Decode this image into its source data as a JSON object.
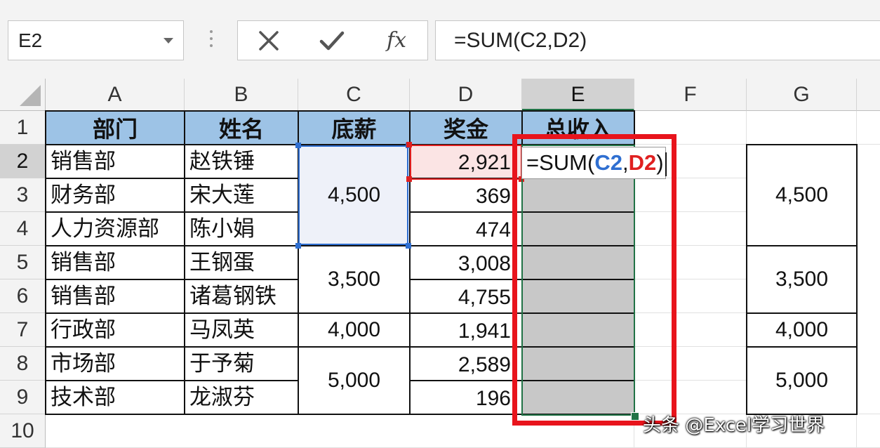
{
  "formula_bar": {
    "name_box": "E2",
    "cancel_icon": "close-icon",
    "enter_icon": "checkmark-icon",
    "fx_label": "fx",
    "formula": "=SUM(C2,D2)"
  },
  "columns": [
    "A",
    "B",
    "C",
    "D",
    "E",
    "F",
    "G"
  ],
  "rows": [
    "1",
    "2",
    "3",
    "4",
    "5",
    "6",
    "7",
    "8",
    "9",
    "10"
  ],
  "selected": {
    "column": "E",
    "row": "2"
  },
  "headers": [
    "部门",
    "姓名",
    "底薪",
    "奖金",
    "总收入"
  ],
  "table": [
    {
      "dept": "销售部",
      "name": "赵铁锤",
      "bonus": "2,921"
    },
    {
      "dept": "财务部",
      "name": "宋大莲",
      "bonus": "369"
    },
    {
      "dept": "人力资源部",
      "name": "陈小娟",
      "bonus": "474"
    },
    {
      "dept": "销售部",
      "name": "王钢蛋",
      "bonus": "3,008"
    },
    {
      "dept": "销售部",
      "name": "诸葛钢铁",
      "bonus": "4,755"
    },
    {
      "dept": "行政部",
      "name": "马凤英",
      "bonus": "1,941"
    },
    {
      "dept": "市场部",
      "name": "于予菊",
      "bonus": "2,589"
    },
    {
      "dept": "技术部",
      "name": "龙淑芬",
      "bonus": "196"
    }
  ],
  "base_salary_merged": [
    {
      "value": "4,500",
      "rows": "2-4"
    },
    {
      "value": "3,500",
      "rows": "5-6"
    },
    {
      "value": "4,000",
      "rows": "7"
    },
    {
      "value": "5,000",
      "rows": "8-9"
    }
  ],
  "g_column_values": [
    "4,500",
    "3,500",
    "4,000",
    "5,000"
  ],
  "edit_cell": {
    "prefix": "=SUM(",
    "ref1": "C2",
    "sep": ",",
    "ref2": "D2",
    "suffix": ")"
  },
  "watermark": "头条 @Excel学习世界",
  "colors": {
    "header_fill": "#9dc3e6",
    "ref_blue": "#2f6fd1",
    "ref_red": "#e02020",
    "highlight_red": "#e8141c",
    "selection_green": "#217346"
  }
}
